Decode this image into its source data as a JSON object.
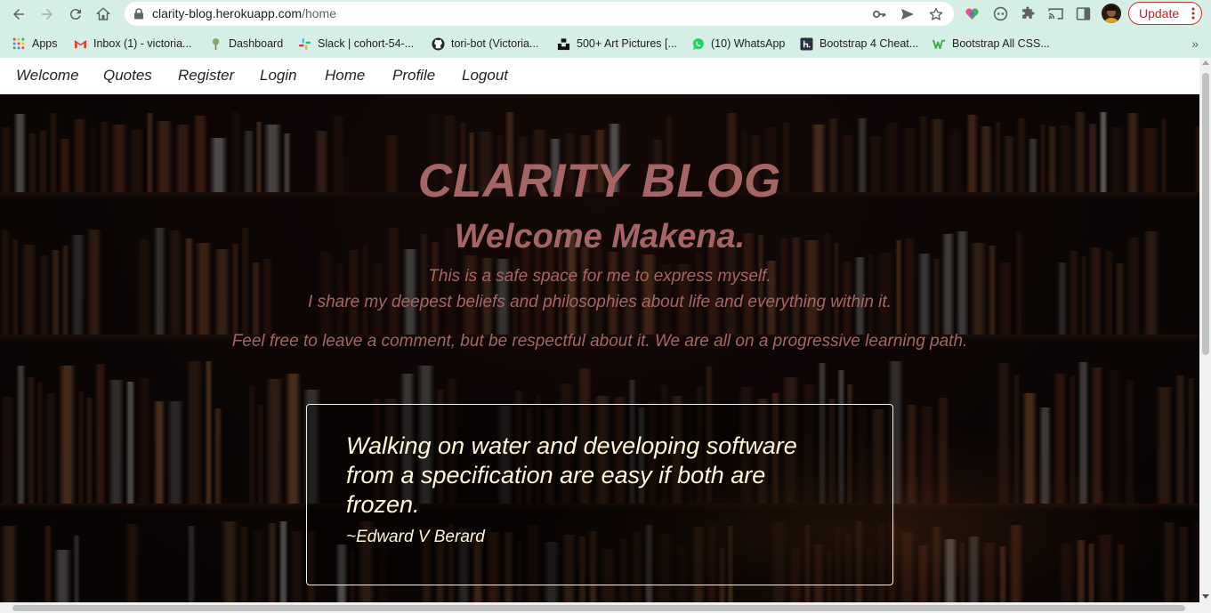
{
  "browser": {
    "url_host": "clarity-blog.herokuapp.com",
    "url_path": "/home",
    "update_label": "Update",
    "bookmarks": [
      {
        "label": "Apps",
        "icon": "apps-grid-icon"
      },
      {
        "label": "Inbox (1) - victoria...",
        "icon": "gmail-icon"
      },
      {
        "label": "Dashboard",
        "icon": "tree-icon"
      },
      {
        "label": "Slack | cohort-54-...",
        "icon": "slack-icon"
      },
      {
        "label": "tori-bot (Victoria...",
        "icon": "github-icon"
      },
      {
        "label": "500+ Art Pictures [...",
        "icon": "unsplash-icon"
      },
      {
        "label": "(10) WhatsApp",
        "icon": "whatsapp-icon"
      },
      {
        "label": "Bootstrap 4 Cheat...",
        "icon": "hackerthemes-icon"
      },
      {
        "label": "Bootstrap All CSS...",
        "icon": "w-icon"
      }
    ],
    "more_bookmarks": "»"
  },
  "navbar": {
    "links": [
      "Welcome",
      "Quotes",
      "Register",
      "Login",
      "Home",
      "Profile",
      "Logout"
    ]
  },
  "hero": {
    "title": "CLARITY BLOG",
    "welcome": "Welcome Makena.",
    "intro_line1": "This is a safe space for me to express myself.",
    "intro_line2": "I share my deepest beliefs and philosophies about life and everything within it.",
    "intro_line3": "Feel free to leave a comment, but be respectful about it. We are all on a progressive learning path.",
    "text_color": "#a56565"
  },
  "quote": {
    "text": "Walking on water and developing software from a specification are easy if both are frozen.",
    "author": "~Edward V Berard",
    "text_color": "#fdf6d8"
  }
}
